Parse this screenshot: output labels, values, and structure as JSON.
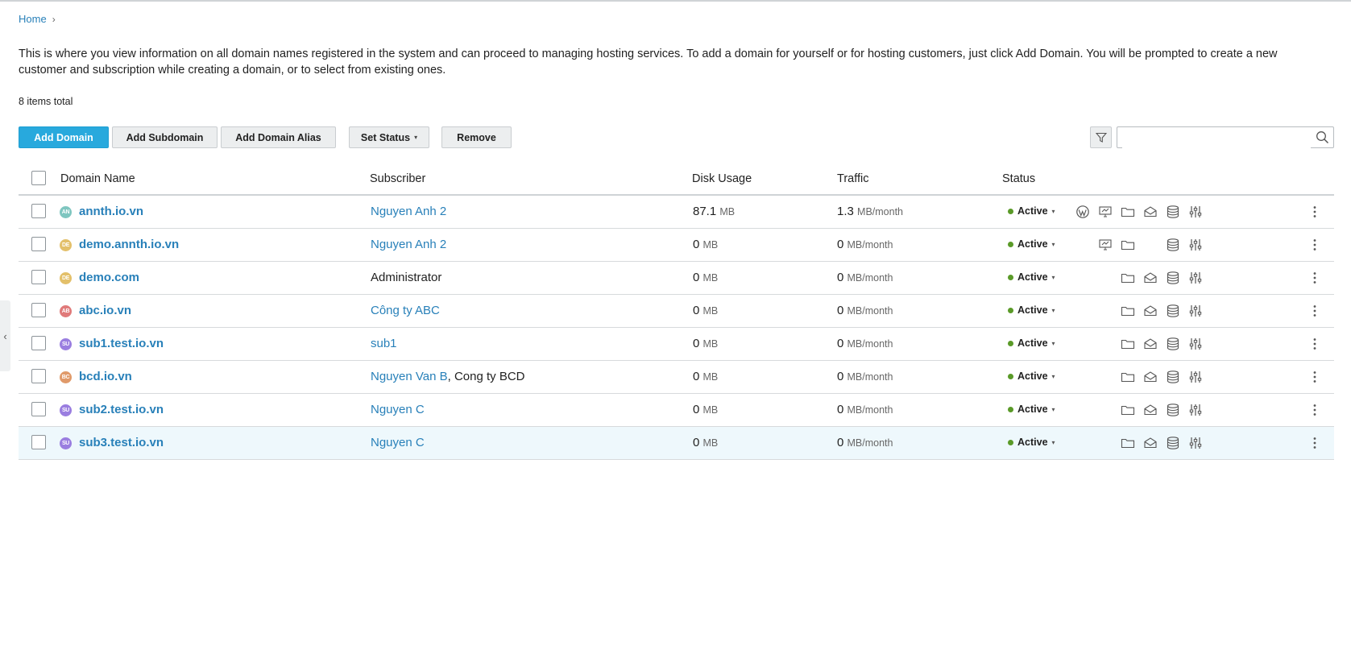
{
  "breadcrumb": {
    "home": "Home",
    "separator": "›"
  },
  "description": "This is where you view information on all domain names registered in the system and can proceed to managing hosting services. To add a domain for yourself or for hosting customers, just click Add Domain. You will be prompted to create a new customer and subscription while creating a domain, or to select from existing ones.",
  "items_total": "8 items total",
  "toolbar": {
    "add_domain": "Add Domain",
    "add_subdomain": "Add Subdomain",
    "add_domain_alias": "Add Domain Alias",
    "set_status": "Set Status",
    "remove": "Remove"
  },
  "search": {
    "placeholder": "",
    "value": ""
  },
  "columns": {
    "domain_name": "Domain Name",
    "subscriber": "Subscriber",
    "disk_usage": "Disk Usage",
    "traffic": "Traffic",
    "status": "Status"
  },
  "colors": {
    "accent": "#28a9dd",
    "link": "#2880b9",
    "active_dot": "#5a9a28"
  },
  "rows": [
    {
      "avatar": "AN",
      "avatar_color": "#7fc6c0",
      "domain": "annth.io.vn",
      "subscriber_link": "Nguyen Anh 2",
      "subscriber_text": "",
      "disk": "87.1",
      "disk_unit": "MB",
      "traffic": "1.3",
      "traffic_unit": "MB/month",
      "status": "Active",
      "icons": [
        "wordpress-icon",
        "monitor-icon",
        "folder-icon",
        "mail-icon",
        "database-icon",
        "settings-sliders-icon"
      ]
    },
    {
      "avatar": "DE",
      "avatar_color": "#e3c06a",
      "domain": "demo.annth.io.vn",
      "subscriber_link": "Nguyen Anh 2",
      "subscriber_text": "",
      "disk": "0",
      "disk_unit": "MB",
      "traffic": "0",
      "traffic_unit": "MB/month",
      "status": "Active",
      "icons": [
        "monitor-icon",
        "folder-icon",
        "database-icon",
        "settings-sliders-icon"
      ]
    },
    {
      "avatar": "DE",
      "avatar_color": "#e3c06a",
      "domain": "demo.com",
      "subscriber_link": "",
      "subscriber_text": "Administrator",
      "disk": "0",
      "disk_unit": "MB",
      "traffic": "0",
      "traffic_unit": "MB/month",
      "status": "Active",
      "icons": [
        "folder-icon",
        "mail-icon",
        "database-icon",
        "settings-sliders-icon"
      ]
    },
    {
      "avatar": "AB",
      "avatar_color": "#e07a7a",
      "domain": "abc.io.vn",
      "subscriber_link": "Công ty ABC",
      "subscriber_text": "",
      "disk": "0",
      "disk_unit": "MB",
      "traffic": "0",
      "traffic_unit": "MB/month",
      "status": "Active",
      "icons": [
        "folder-icon",
        "mail-icon",
        "database-icon",
        "settings-sliders-icon"
      ]
    },
    {
      "avatar": "SU",
      "avatar_color": "#9a7ee0",
      "domain": "sub1.test.io.vn",
      "subscriber_link": "sub1",
      "subscriber_text": "",
      "disk": "0",
      "disk_unit": "MB",
      "traffic": "0",
      "traffic_unit": "MB/month",
      "status": "Active",
      "icons": [
        "folder-icon",
        "mail-icon",
        "database-icon",
        "settings-sliders-icon"
      ]
    },
    {
      "avatar": "BC",
      "avatar_color": "#e09a6a",
      "domain": "bcd.io.vn",
      "subscriber_link": "Nguyen Van B",
      "subscriber_text": ", Cong ty BCD",
      "disk": "0",
      "disk_unit": "MB",
      "traffic": "0",
      "traffic_unit": "MB/month",
      "status": "Active",
      "icons": [
        "folder-icon",
        "mail-icon",
        "database-icon",
        "settings-sliders-icon"
      ]
    },
    {
      "avatar": "SU",
      "avatar_color": "#9a7ee0",
      "domain": "sub2.test.io.vn",
      "subscriber_link": "Nguyen C",
      "subscriber_text": "",
      "disk": "0",
      "disk_unit": "MB",
      "traffic": "0",
      "traffic_unit": "MB/month",
      "status": "Active",
      "icons": [
        "folder-icon",
        "mail-icon",
        "database-icon",
        "settings-sliders-icon"
      ]
    },
    {
      "avatar": "SU",
      "avatar_color": "#9a7ee0",
      "domain": "sub3.test.io.vn",
      "subscriber_link": "Nguyen C",
      "subscriber_text": "",
      "disk": "0",
      "disk_unit": "MB",
      "traffic": "0",
      "traffic_unit": "MB/month",
      "status": "Active",
      "icons": [
        "folder-icon",
        "mail-icon",
        "database-icon",
        "settings-sliders-icon"
      ]
    }
  ]
}
